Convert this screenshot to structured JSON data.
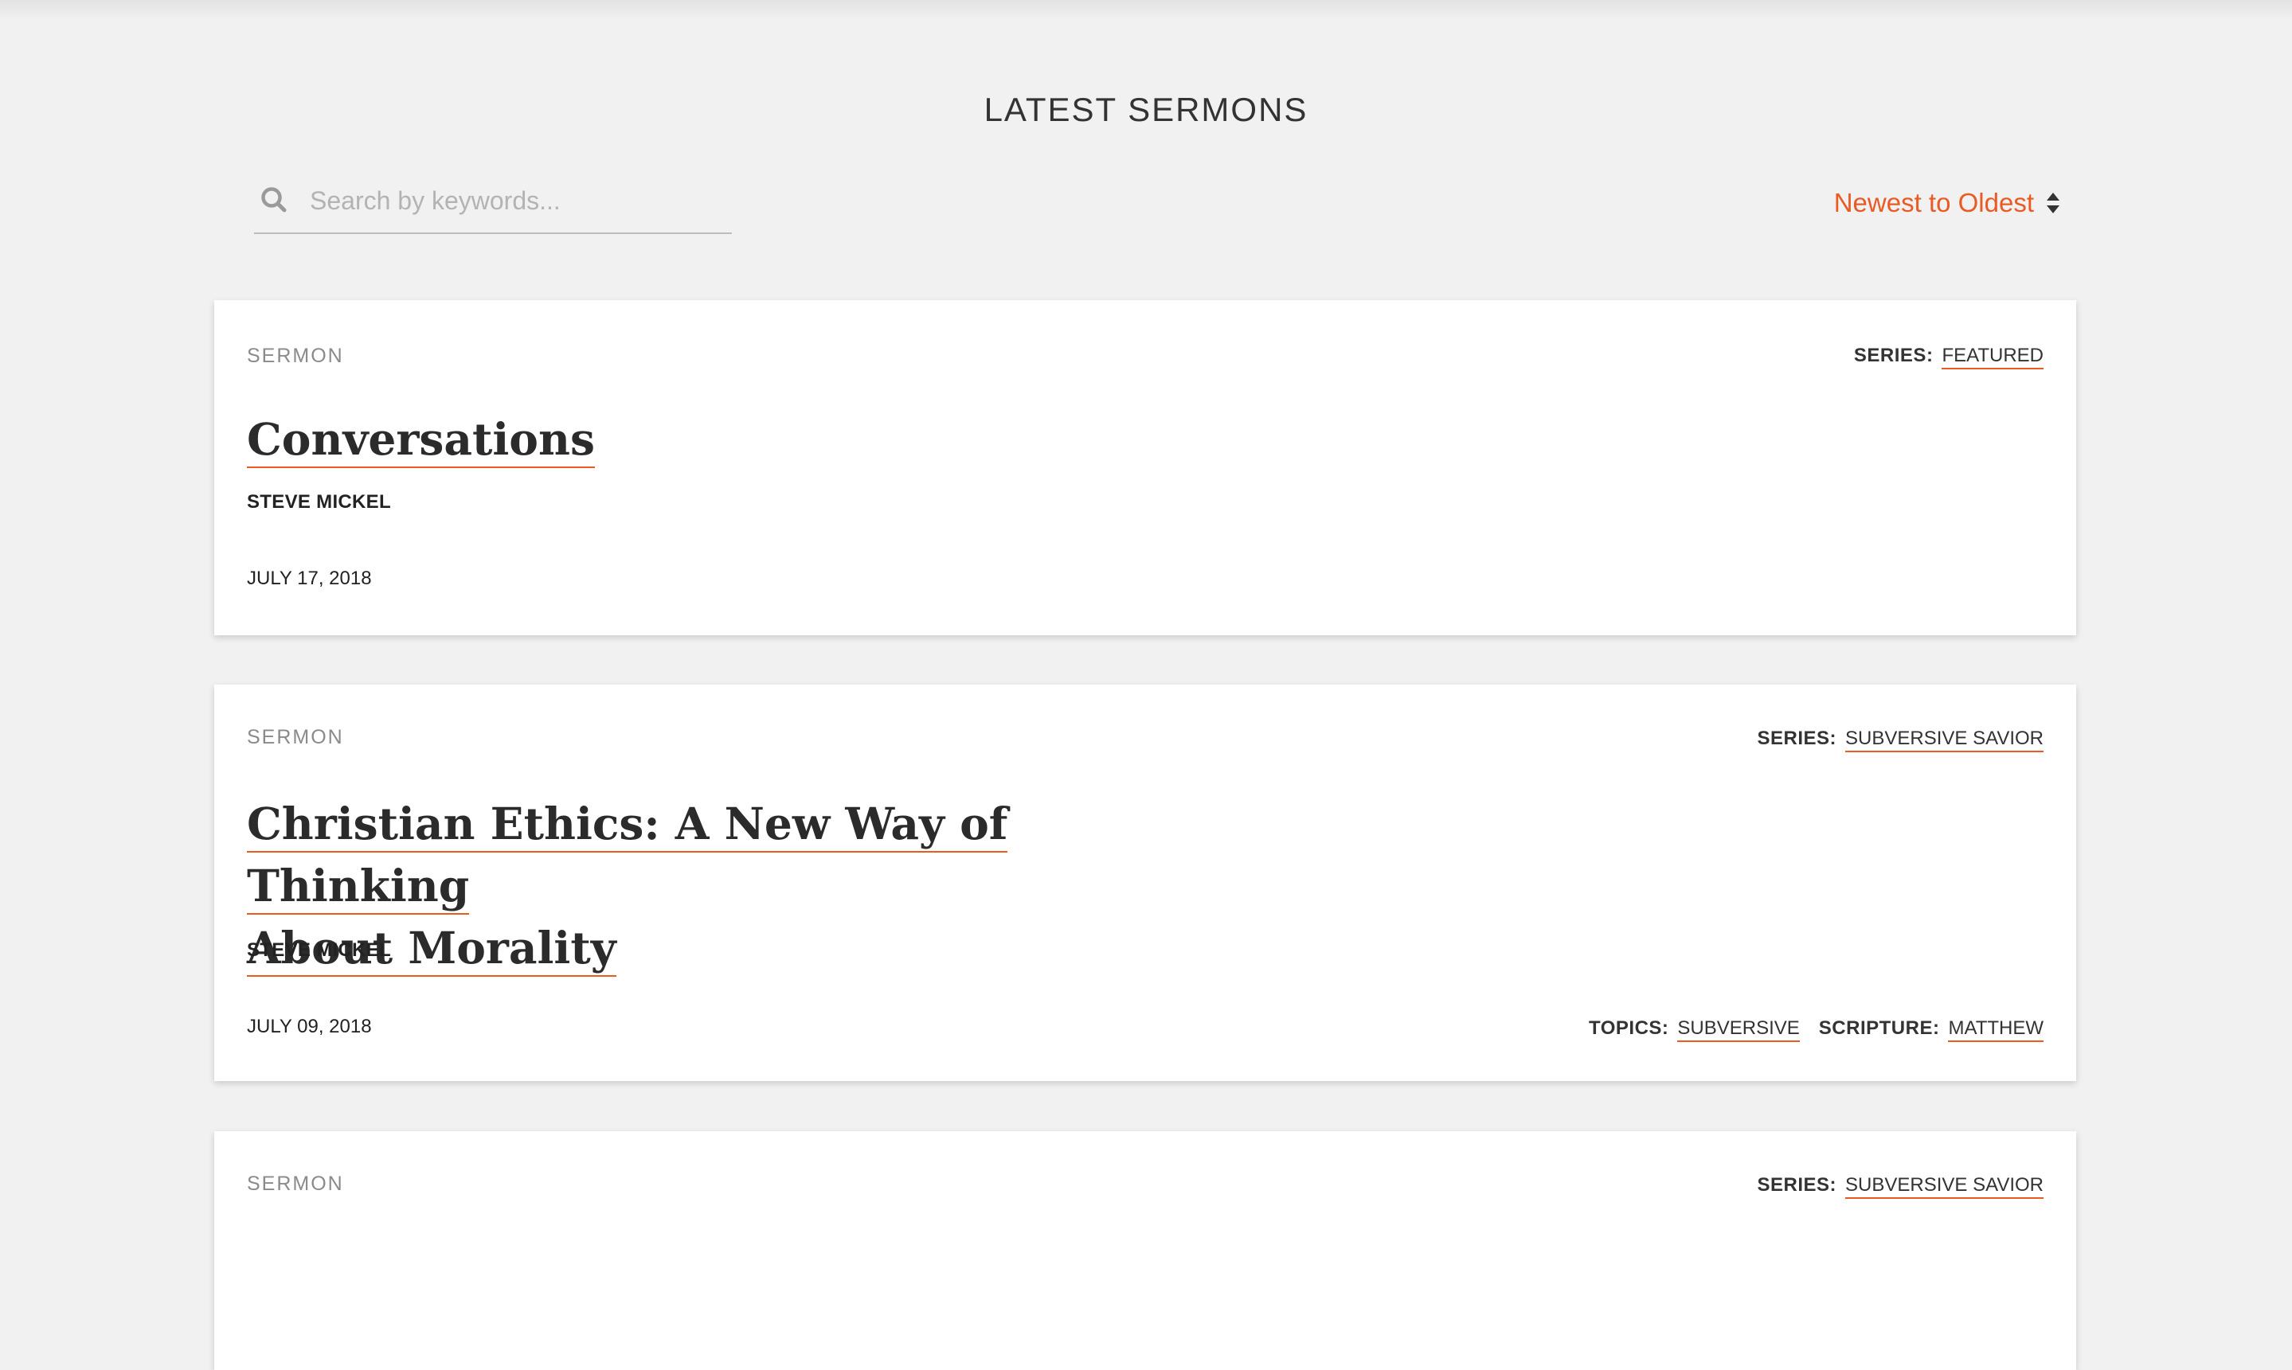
{
  "page": {
    "title": "LATEST SERMONS"
  },
  "search": {
    "placeholder": "Search by keywords...",
    "value": ""
  },
  "sort": {
    "label": "Newest to Oldest"
  },
  "colors": {
    "accent": "#ea5a23",
    "background": "#f1f1f1",
    "card": "#ffffff"
  },
  "sermons": [
    {
      "type": "SERMON",
      "series_label": "SERIES:",
      "series": "FEATURED",
      "title": "Conversations",
      "speaker": "STEVE MICKEL",
      "date": "JULY 17, 2018"
    },
    {
      "type": "SERMON",
      "series_label": "SERIES:",
      "series": "SUBVERSIVE SAVIOR",
      "title_line1": "Christian Ethics: A New Way of Thinking",
      "title_line2": "About Morality",
      "speaker": "STEVE MICKEL",
      "date": "JULY 09, 2018",
      "topics_label": "TOPICS:",
      "topics": "SUBVERSIVE",
      "scripture_label": "SCRIPTURE:",
      "scripture": "MATTHEW"
    },
    {
      "type": "SERMON",
      "series_label": "SERIES:",
      "series": "SUBVERSIVE SAVIOR"
    }
  ]
}
